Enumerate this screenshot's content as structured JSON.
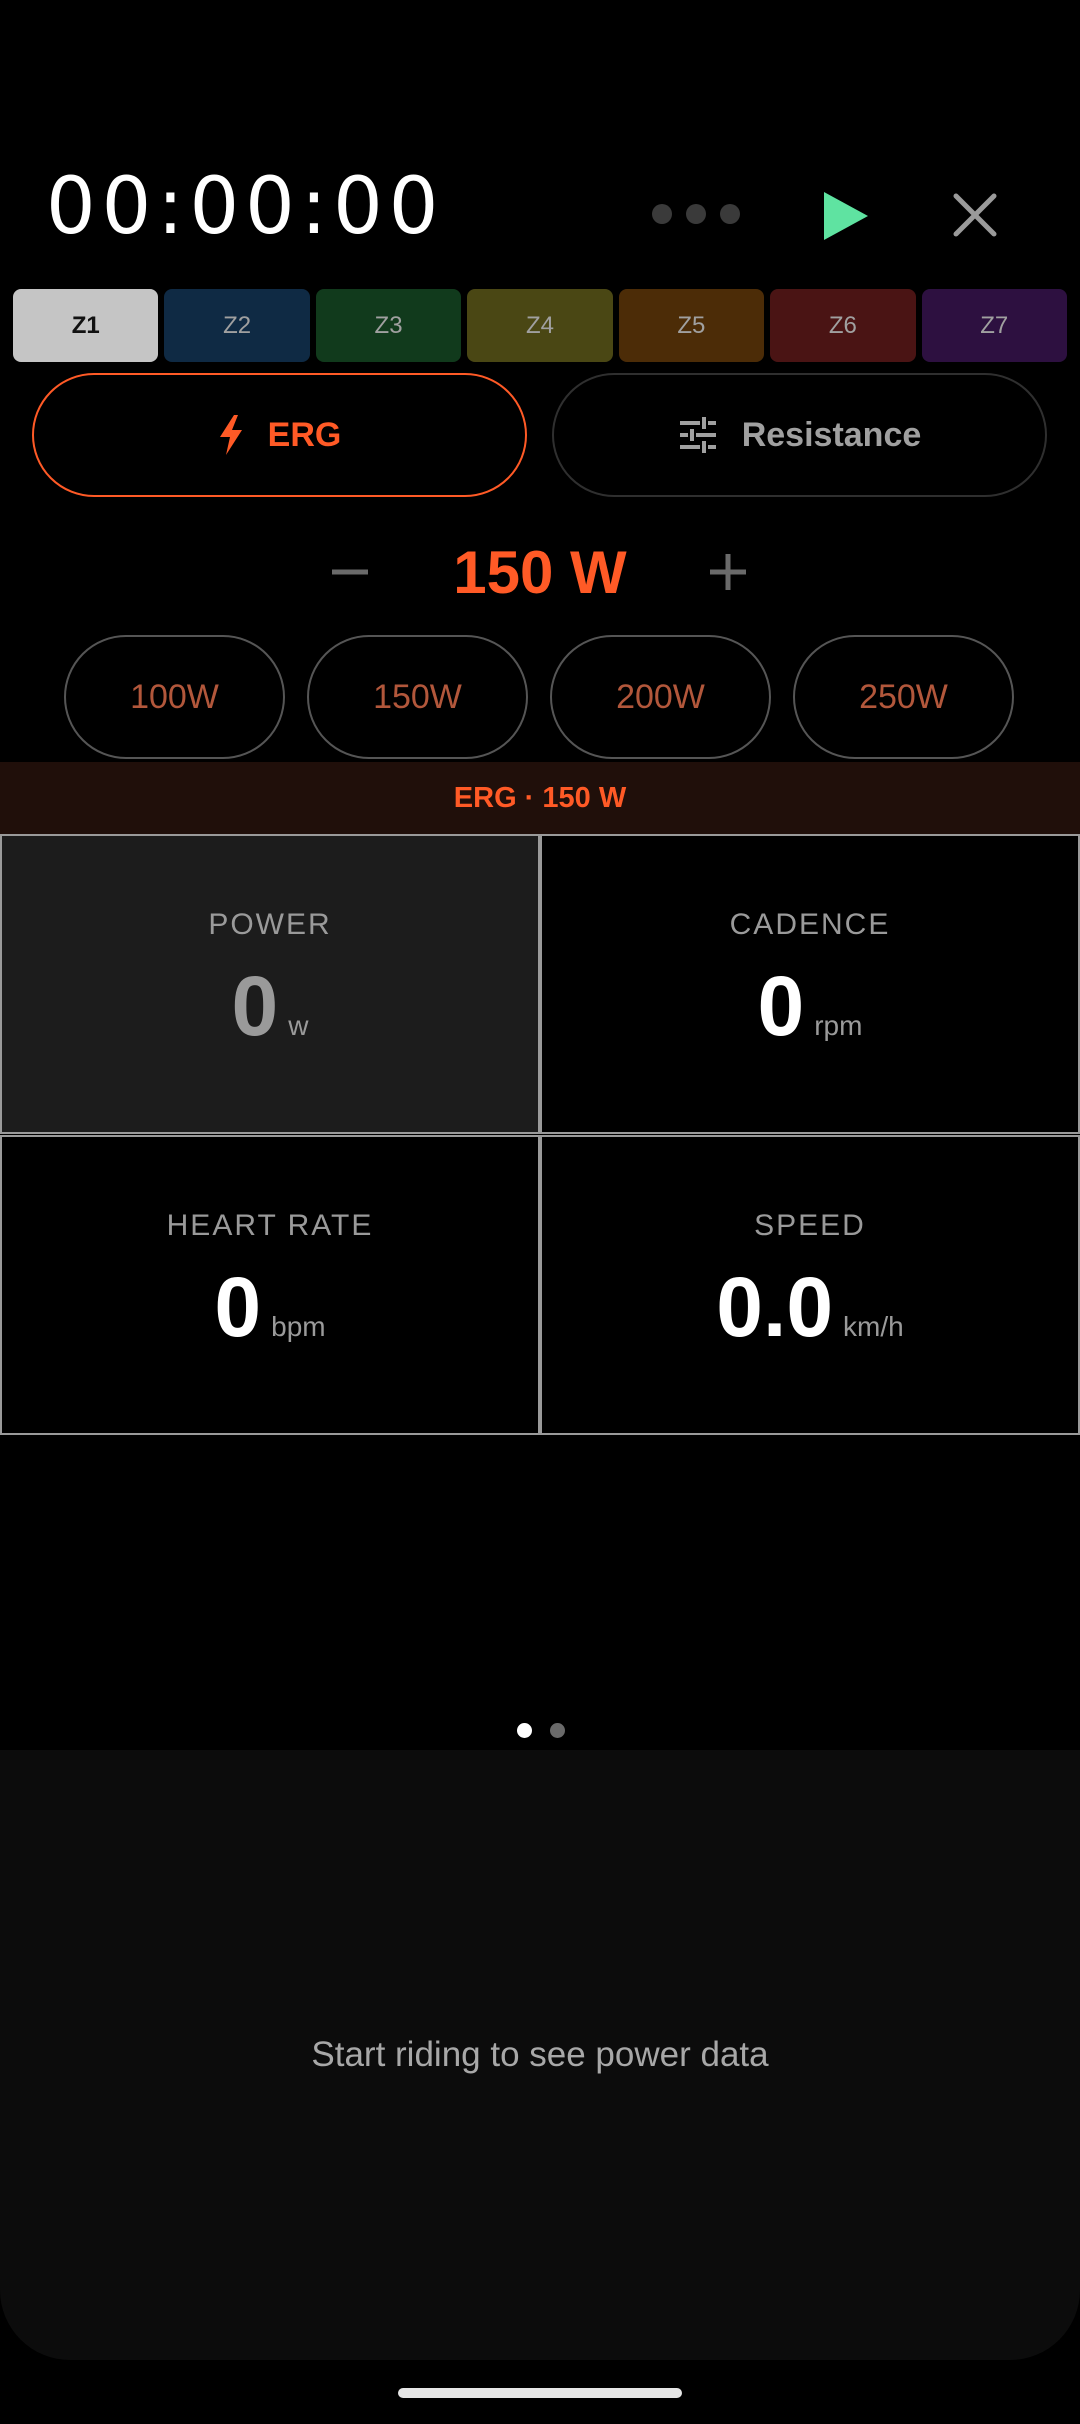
{
  "header": {
    "timer": "00:00:00",
    "icons": {
      "more": "more-dots-icon",
      "play": "play-icon",
      "close": "close-icon"
    },
    "play_color": "#5fe3a1",
    "close_color": "#9a9a9a"
  },
  "zones": [
    {
      "label": "Z1",
      "color": "#c5c5c5",
      "active": true
    },
    {
      "label": "Z2",
      "color": "#0f2a44",
      "active": false
    },
    {
      "label": "Z3",
      "color": "#113a1c",
      "active": false
    },
    {
      "label": "Z4",
      "color": "#4a4714",
      "active": false
    },
    {
      "label": "Z5",
      "color": "#4c2c07",
      "active": false
    },
    {
      "label": "Z6",
      "color": "#4a1414",
      "active": false
    },
    {
      "label": "Z7",
      "color": "#2d1040",
      "active": false
    }
  ],
  "mode": {
    "erg_label": "ERG",
    "erg_icon": "bolt-icon",
    "resistance_label": "Resistance",
    "resistance_icon": "sliders-icon",
    "selected": "ERG",
    "accent": "#ff5a26"
  },
  "target": {
    "value": "150 W",
    "decrease": "−",
    "increase": "+"
  },
  "presets": [
    "100W",
    "150W",
    "200W",
    "250W"
  ],
  "banner": {
    "text": "ERG · 150 W"
  },
  "metrics": [
    {
      "label": "POWER",
      "value": "0",
      "unit": "w",
      "highlighted": true
    },
    {
      "label": "CADENCE",
      "value": "0",
      "unit": "rpm",
      "highlighted": false
    },
    {
      "label": "HEART RATE",
      "value": "0",
      "unit": "bpm",
      "highlighted": false
    },
    {
      "label": "SPEED",
      "value": "0.0",
      "unit": "km/h",
      "highlighted": false
    }
  ],
  "pager": {
    "pages": 2,
    "current": 1,
    "active_color": "#ffffff",
    "inactive_color": "#6a6a6a"
  },
  "panel": {
    "message": "Start riding to see power data"
  }
}
